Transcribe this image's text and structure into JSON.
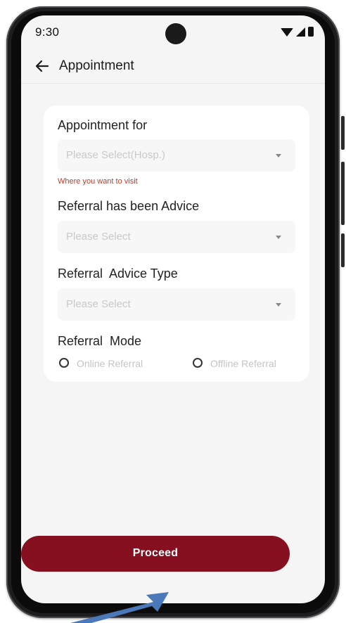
{
  "status_bar": {
    "time": "9:30",
    "icons": [
      "wifi-icon",
      "signal-icon",
      "battery-icon"
    ]
  },
  "header": {
    "title": "Appointment",
    "back_icon": "arrow-left-icon"
  },
  "form": {
    "appointment_for": {
      "label": "Appointment for",
      "placeholder": "Please Select(Hosp.)",
      "helper_text": "Where you want to visit"
    },
    "referral_advice": {
      "label": "Referral has been Advice",
      "placeholder": "Please Select"
    },
    "referral_advice_type": {
      "label": "Referral  Advice Type",
      "placeholder": "Please Select"
    },
    "referral_mode": {
      "label": "Referral  Mode",
      "options": [
        {
          "label": "Online Referral",
          "selected": false
        },
        {
          "label": "Offline Referral",
          "selected": false
        }
      ]
    }
  },
  "proceed_button": {
    "label": "Proceed"
  },
  "colors": {
    "accent": "#86101f",
    "helper_text": "#c0392b",
    "screen_bg": "#f5f5f5",
    "card_bg": "#ffffff",
    "pointer_arrow": "#4a78b8"
  }
}
